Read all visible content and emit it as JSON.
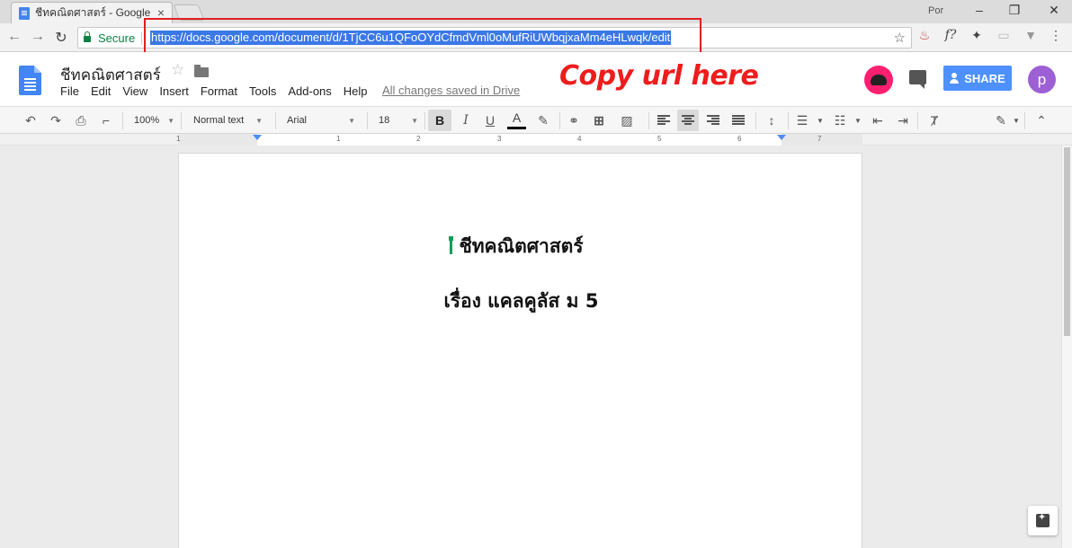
{
  "browser": {
    "tab_title": "ชีทคณิตศาสตร์ - Google Docs",
    "tab_close": "×",
    "profile_name": "Por",
    "secure_label": "Secure",
    "url": "https://docs.google.com/document/d/1TjCC6u1QFoOYdCfmdVml0oMufRiUWbqjxaMm4eHLwqk/edit",
    "icons": [
      "back-icon",
      "forward-icon",
      "reload-icon",
      "star-icon",
      "java-icon",
      "fx-icon",
      "fish-icon",
      "cast-icon",
      "vpn-icon",
      "menu-icon"
    ]
  },
  "annotation": {
    "text": "Copy url here",
    "color": "#ee1c1c"
  },
  "doc": {
    "title": "ชีทคณิตศาสตร์",
    "menu": [
      "File",
      "Edit",
      "View",
      "Insert",
      "Format",
      "Tools",
      "Add-ons",
      "Help"
    ],
    "save_status": "All changes saved in Drive",
    "share_label": "SHARE",
    "avatar_letter": "p",
    "accent": "#4d90fe"
  },
  "format_toolbar": {
    "zoom": "100%",
    "style": "Normal text",
    "font": "Arial",
    "size": "18",
    "bold": "B",
    "italic": "I",
    "underline": "U",
    "text_color": "A"
  },
  "ruler": {
    "numbers": [
      "1",
      "1",
      "2",
      "3",
      "4",
      "5",
      "6",
      "7"
    ]
  },
  "content": {
    "heading1": "ชีทคณิตศาสตร์",
    "heading2": "เรื่อง แคลคูลัส ม 5"
  }
}
